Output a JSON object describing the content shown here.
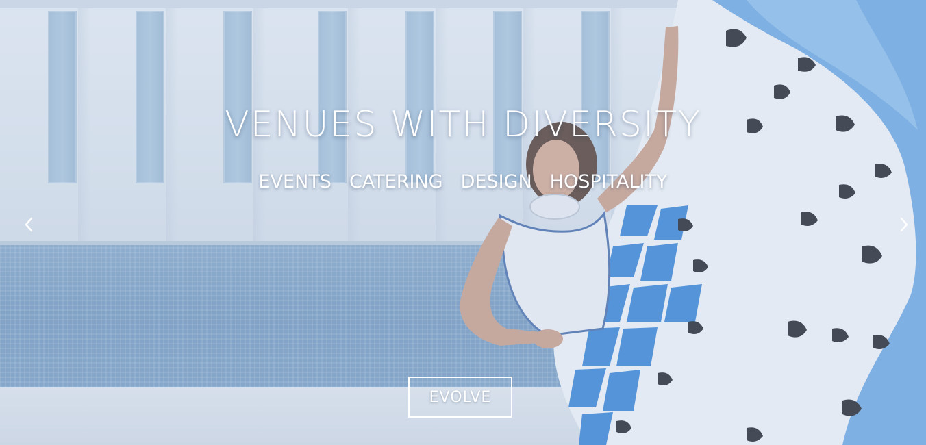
{
  "hero": {
    "title": "VENUES WITH DIVERSITY",
    "services": [
      "EVENTS",
      "CATERING",
      "DESIGN",
      "HOSPITALITY"
    ],
    "cta_label": "EVOLVE"
  },
  "controls": {
    "prev_icon": "chevron-left-icon",
    "next_icon": "chevron-right-icon"
  },
  "colors": {
    "text": "#ffffff",
    "tile_blue": "#6f98c0",
    "wall": "#e6edf5",
    "skirt_blue": "#2f7fd6"
  }
}
